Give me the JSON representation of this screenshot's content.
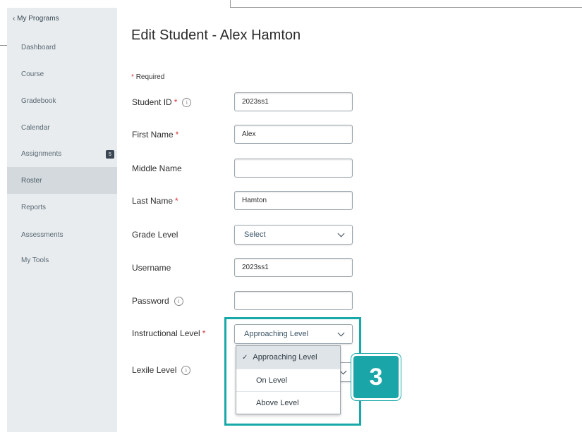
{
  "sidebar": {
    "back_label": "My Programs",
    "items": [
      {
        "label": "Dashboard"
      },
      {
        "label": "Course"
      },
      {
        "label": "Gradebook"
      },
      {
        "label": "Calendar"
      },
      {
        "label": "Assignments",
        "badge": "5"
      },
      {
        "label": "Roster",
        "active": true
      },
      {
        "label": "Reports"
      },
      {
        "label": "Assessments"
      },
      {
        "label": "My Tools"
      }
    ]
  },
  "main": {
    "title": "Edit Student - Alex Hamton",
    "required_note": "Required",
    "fields": {
      "student_id": {
        "label": "Student ID",
        "value": "2023ss1"
      },
      "first_name": {
        "label": "First Name",
        "value": "Alex"
      },
      "middle_name": {
        "label": "Middle Name",
        "value": ""
      },
      "last_name": {
        "label": "Last Name",
        "value": "Hamton"
      },
      "grade_level": {
        "label": "Grade Level",
        "value": "Select"
      },
      "username": {
        "label": "Username",
        "value": "2023ss1"
      },
      "password": {
        "label": "Password",
        "value": ""
      },
      "instructional_level": {
        "label": "Instructional Level",
        "value": "Approaching Level"
      },
      "lexile_level": {
        "label": "Lexile Level"
      }
    },
    "dropdown_options": [
      "Approaching Level",
      "On Level",
      "Above Level"
    ]
  },
  "callout": {
    "step": "3"
  },
  "colors": {
    "accent": "#1aa6a8",
    "required": "#d9363e",
    "sidebar_bg": "#e8ecee"
  }
}
